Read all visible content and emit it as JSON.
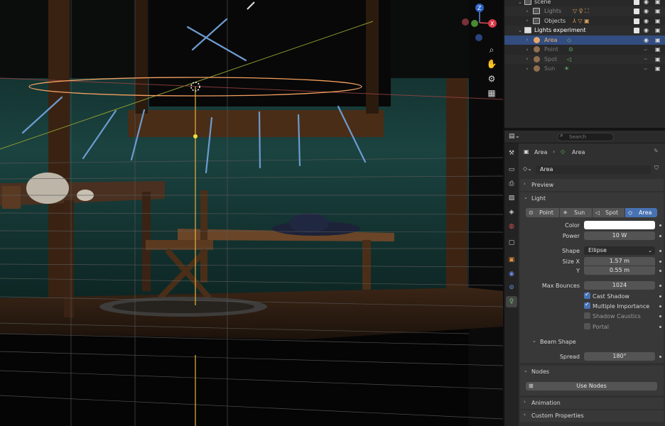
{
  "outliner": {
    "rows": [
      {
        "label": "scene"
      },
      {
        "label": "Lights"
      },
      {
        "label": "Objects"
      },
      {
        "label": "Lights experiment"
      },
      {
        "label": "Area"
      },
      {
        "label": "Point"
      },
      {
        "label": "Spot"
      },
      {
        "label": "Sun"
      }
    ]
  },
  "properties": {
    "search_placeholder": "Search",
    "breadcrumb": {
      "object": "Area",
      "data": "Area"
    },
    "datablock_name": "Area",
    "panels": {
      "preview": "Preview",
      "light": "Light",
      "nodes": "Nodes",
      "animation": "Animation",
      "custom_properties": "Custom Properties"
    },
    "light_types": [
      "Point",
      "Sun",
      "Spot",
      "Area"
    ],
    "light_type_selected": "Area",
    "fields": {
      "color_label": "Color",
      "color_value": "#ffffff",
      "power_label": "Power",
      "power_value": "10 W",
      "shape_label": "Shape",
      "shape_value": "Ellipse",
      "size_x_label": "Size X",
      "size_x_value": "1.57 m",
      "size_y_label": "Y",
      "size_y_value": "0.55 m",
      "max_bounces_label": "Max Bounces",
      "max_bounces_value": "1024"
    },
    "checkboxes": [
      {
        "label": "Cast Shadow",
        "checked": true
      },
      {
        "label": "Multiple Importance",
        "checked": true
      },
      {
        "label": "Shadow Caustics",
        "checked": false
      },
      {
        "label": "Portal",
        "checked": false
      }
    ],
    "beam_shape": {
      "title": "Beam Shape",
      "spread_label": "Spread",
      "spread_value": "180°"
    },
    "use_nodes": "Use Nodes"
  },
  "gizmo": {
    "z": "Z",
    "x": "X"
  }
}
